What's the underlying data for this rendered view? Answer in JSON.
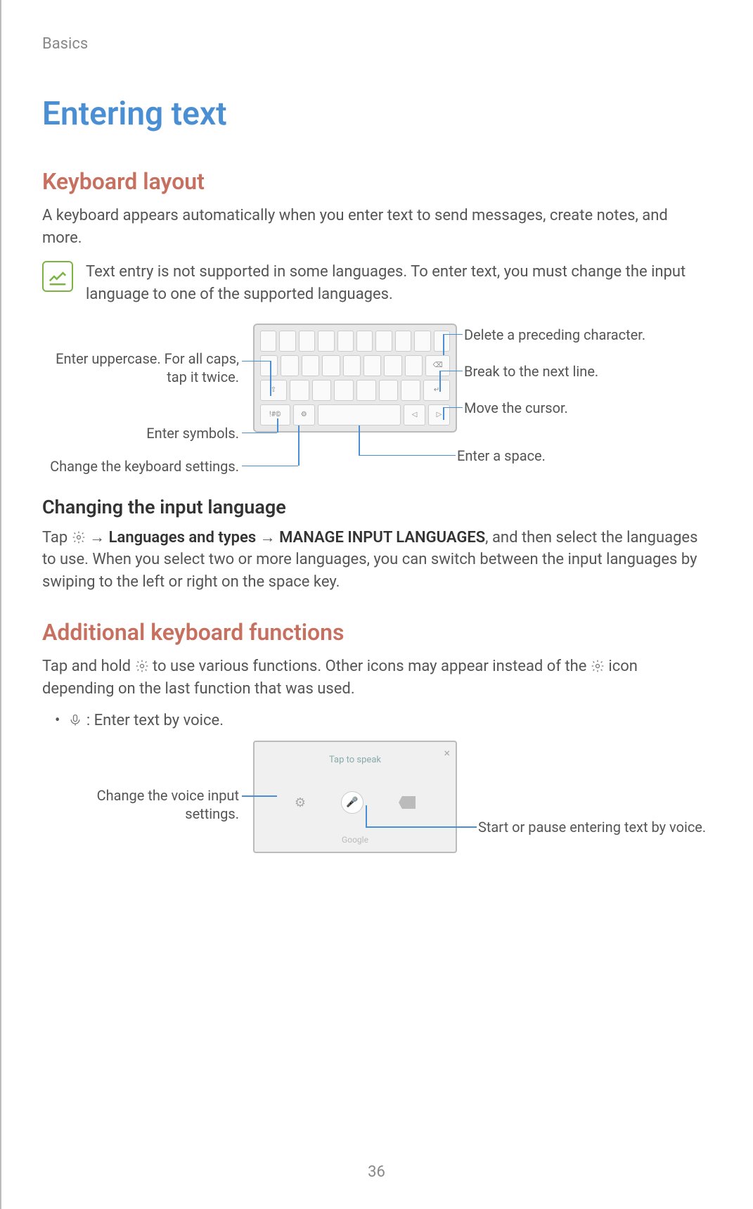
{
  "breadcrumb": "Basics",
  "title": "Entering text",
  "sections": {
    "layout": {
      "heading": "Keyboard layout",
      "intro": "A keyboard appears automatically when you enter text to send messages, create notes, and more.",
      "note": "Text entry is not supported in some languages. To enter text, you must change the input language to one of the supported languages.",
      "callouts": {
        "uppercase": "Enter uppercase. For all caps, tap it twice.",
        "symbols": "Enter symbols.",
        "settings": "Change the keyboard settings.",
        "delete": "Delete a preceding character.",
        "nextline": "Break to the next line.",
        "cursor": "Move the cursor.",
        "space": "Enter a space."
      },
      "sub_heading": "Changing the input language",
      "sub_text_1": "Tap ",
      "sub_text_2": " → ",
      "sub_bold_1": "Languages and types",
      "sub_text_3": " → ",
      "sub_bold_2": "MANAGE INPUT LANGUAGES",
      "sub_text_4": ", and then select the languages to use. When you select two or more languages, you can switch between the input languages by swiping to the left or right on the space key."
    },
    "additional": {
      "heading": "Additional keyboard functions",
      "intro_1": "Tap and hold ",
      "intro_2": " to use various functions. Other icons may appear instead of the ",
      "intro_3": " icon depending on the last function that was used.",
      "bullet_text": " : Enter text by voice.",
      "voice_callouts": {
        "settings": "Change the voice input settings.",
        "start": "Start or pause entering text by voice."
      },
      "voice_prompt": "Tap to speak",
      "voice_brand": "Google"
    }
  },
  "page_number": "36"
}
